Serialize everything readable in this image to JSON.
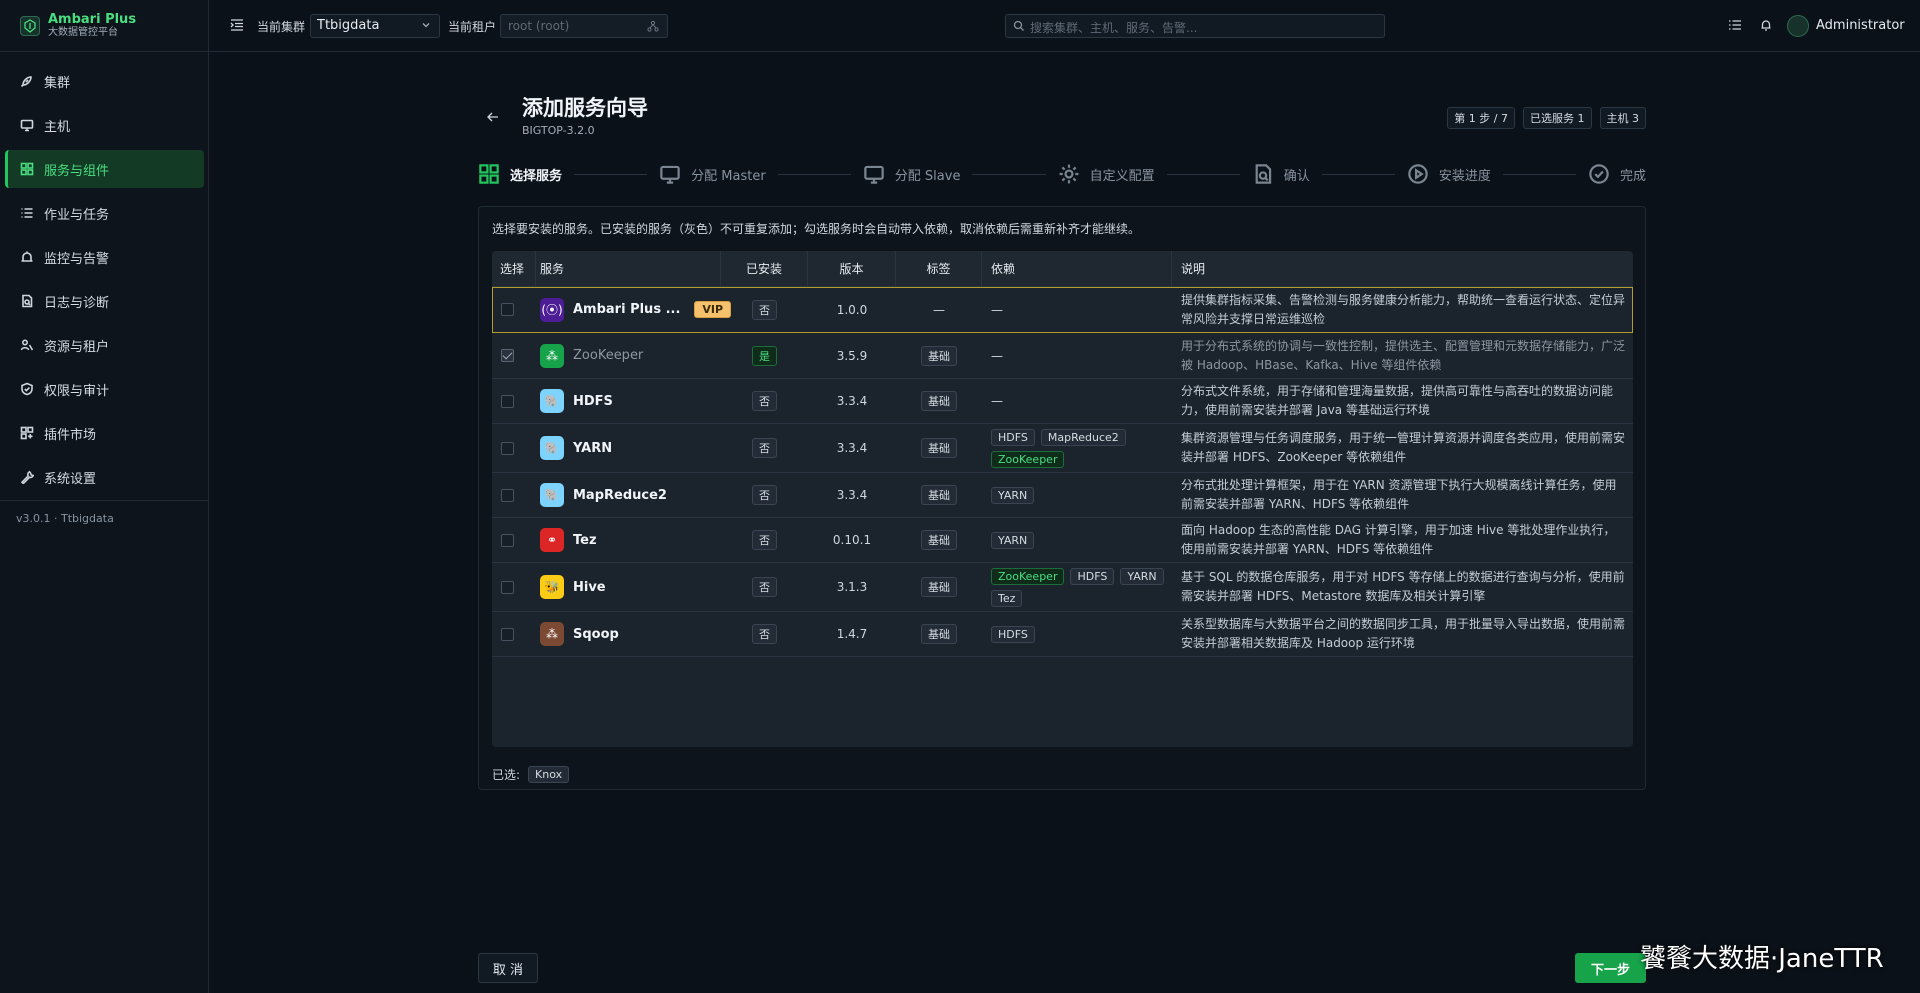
{
  "brand": {
    "name": "Ambari Plus",
    "subtitle": "大数据管控平台"
  },
  "sidebar": {
    "items": [
      {
        "label": "集群",
        "icon": "rocket-icon"
      },
      {
        "label": "主机",
        "icon": "monitor-icon"
      },
      {
        "label": "服务与组件",
        "icon": "grid-icon",
        "active": true
      },
      {
        "label": "作业与任务",
        "icon": "list-icon"
      },
      {
        "label": "监控与告警",
        "icon": "alarm-icon"
      },
      {
        "label": "日志与诊断",
        "icon": "file-search-icon"
      },
      {
        "label": "资源与租户",
        "icon": "users-icon"
      },
      {
        "label": "权限与审计",
        "icon": "shield-icon"
      },
      {
        "label": "插件市场",
        "icon": "plugin-icon"
      },
      {
        "label": "系统设置",
        "icon": "wrench-icon"
      }
    ],
    "version": "v3.0.1 · Ttbigdata"
  },
  "topbar": {
    "cluster_label": "当前集群",
    "cluster_value": "Ttbigdata",
    "tenant_label": "当前租户",
    "tenant_placeholder": "root (root)",
    "search_placeholder": "搜索集群、主机、服务、告警...",
    "user": "Administrator"
  },
  "wizard": {
    "title": "添加服务向导",
    "subtitle": "BIGTOP-3.2.0",
    "badges": [
      "第 1 步 / 7",
      "已选服务 1",
      "主机 3"
    ],
    "steps": [
      {
        "label": "选择服务",
        "icon": "grid-icon",
        "active": true
      },
      {
        "label": "分配 Master",
        "icon": "monitor-icon"
      },
      {
        "label": "分配 Slave",
        "icon": "monitor-icon"
      },
      {
        "label": "自定义配置",
        "icon": "gear-icon"
      },
      {
        "label": "确认",
        "icon": "file-search-icon"
      },
      {
        "label": "安装进度",
        "icon": "play-circle-icon"
      },
      {
        "label": "完成",
        "icon": "check-circle-icon"
      }
    ],
    "notice": "选择要安装的服务。已安装的服务（灰色）不可重复添加；勾选服务时会自动带入依赖，取消依赖后需重新补齐才能继续。",
    "columns": [
      "选择",
      "服务",
      "已安装",
      "版本",
      "标签",
      "依赖",
      "说明"
    ],
    "rows": [
      {
        "name": "Ambari Plus ...",
        "vip": "VIP",
        "installed": "否",
        "version": "1.0.0",
        "tag": "—",
        "deps": [
          "—"
        ],
        "desc": "提供集群指标采集、告警检测与服务健康分析能力，帮助统一查看运行状态、定位异常风险并支撑日常运维巡检",
        "icon_color": "#4c1d95",
        "icon_glyph": "(⦿)"
      },
      {
        "name": "ZooKeeper",
        "installed": "是",
        "version": "3.5.9",
        "tag": "基础",
        "deps": [
          "—"
        ],
        "desc": "用于分布式系统的协调与一致性控制，提供选主、配置管理和元数据存储能力，广泛被 Hadoop、HBase、Kafka、Hive 等组件依赖",
        "icon_color": "#16a34a",
        "icon_glyph": "⁂",
        "dim": true,
        "checked": true
      },
      {
        "name": "HDFS",
        "installed": "否",
        "version": "3.3.4",
        "tag": "基础",
        "deps": [
          "—"
        ],
        "desc": "分布式文件系统，用于存储和管理海量数据，提供高可靠性与高吞吐的数据访问能力，使用前需安装并部署 Java 等基础运行环境",
        "icon_color": "#7dd3fc",
        "icon_glyph": "🐘"
      },
      {
        "name": "YARN",
        "installed": "否",
        "version": "3.3.4",
        "tag": "基础",
        "deps": [
          "HDFS",
          "MapReduce2",
          "ZooKeeper"
        ],
        "desc": "集群资源管理与任务调度服务，用于统一管理计算资源并调度各类应用，使用前需安装并部署 HDFS、ZooKeeper 等依赖组件",
        "icon_color": "#7dd3fc",
        "icon_glyph": "🐘"
      },
      {
        "name": "MapReduce2",
        "installed": "否",
        "version": "3.3.4",
        "tag": "基础",
        "deps": [
          "YARN"
        ],
        "desc": "分布式批处理计算框架，用于在 YARN 资源管理下执行大规模离线计算任务，使用前需安装并部署 YARN、HDFS 等依赖组件",
        "icon_color": "#7dd3fc",
        "icon_glyph": "🐘"
      },
      {
        "name": "Tez",
        "installed": "否",
        "version": "0.10.1",
        "tag": "基础",
        "deps": [
          "YARN"
        ],
        "desc": "面向 Hadoop 生态的高性能 DAG 计算引擎，用于加速 Hive 等批处理作业执行，使用前需安装并部署 YARN、HDFS 等依赖组件",
        "icon_color": "#dc2626",
        "icon_glyph": "⚭"
      },
      {
        "name": "Hive",
        "installed": "否",
        "version": "3.1.3",
        "tag": "基础",
        "deps": [
          "ZooKeeper",
          "HDFS",
          "YARN",
          "Tez"
        ],
        "desc": "基于 SQL 的数据仓库服务，用于对 HDFS 等存储上的数据进行查询与分析，使用前需安装并部署 HDFS、Metastore 数据库及相关计算引擎",
        "icon_color": "#facc15",
        "icon_glyph": "🐝"
      },
      {
        "name": "Sqoop",
        "installed": "否",
        "version": "1.4.7",
        "tag": "基础",
        "deps": [
          "HDFS"
        ],
        "desc": "关系型数据库与大数据平台之间的数据同步工具，用于批量导入导出数据，使用前需安装并部署相关数据库及 Hadoop 运行环境",
        "icon_color": "#7c4a32",
        "icon_glyph": "⁂"
      }
    ],
    "selected_label": "已选:",
    "selected_items": [
      "Knox"
    ],
    "cancel_label": "取 消",
    "next_label": "下一步"
  },
  "watermark": "饕餮大数据·JaneTTR"
}
